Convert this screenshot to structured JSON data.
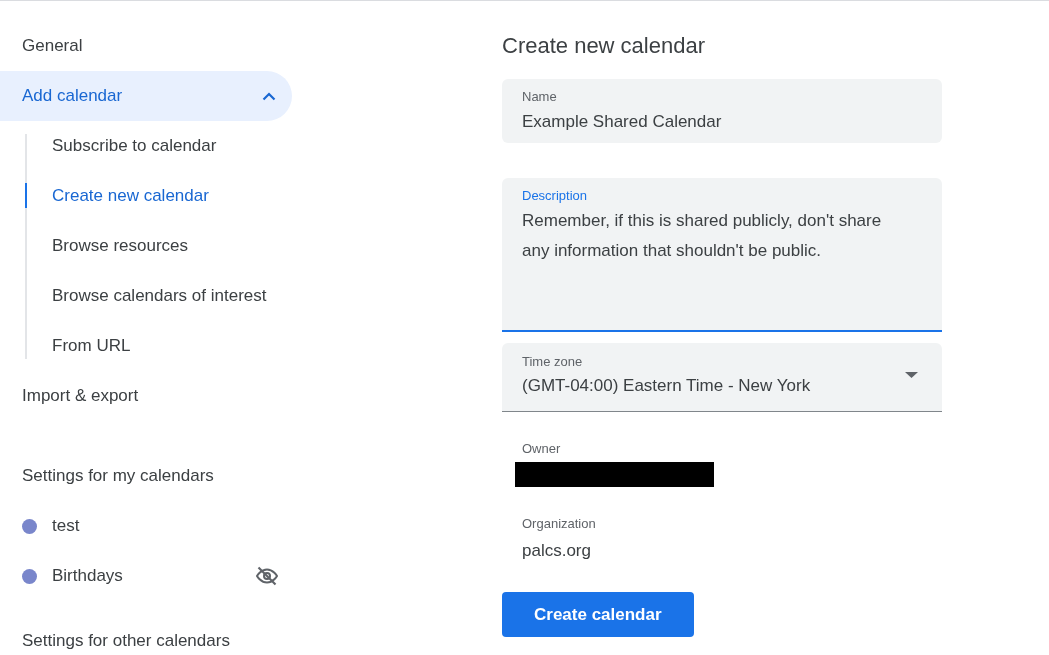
{
  "sidebar": {
    "items": [
      {
        "label": "General",
        "selected": false
      },
      {
        "label": "Add calendar",
        "selected": true,
        "expanded": true,
        "children": [
          {
            "label": "Subscribe to calendar",
            "selected": false
          },
          {
            "label": "Create new calendar",
            "selected": true
          },
          {
            "label": "Browse resources",
            "selected": false
          },
          {
            "label": "Browse calendars of interest",
            "selected": false
          },
          {
            "label": "From URL",
            "selected": false
          }
        ]
      },
      {
        "label": "Import & export",
        "selected": false
      }
    ],
    "sections": [
      {
        "title": "Settings for my calendars",
        "calendars": [
          {
            "name": "test",
            "color": "#7986cb",
            "hidden": false
          },
          {
            "name": "Birthdays",
            "color": "#7986cb",
            "hidden": true
          }
        ]
      },
      {
        "title": "Settings for other calendars"
      }
    ]
  },
  "form": {
    "title": "Create new calendar",
    "fields": [
      {
        "kind": "text",
        "label": "Name",
        "value": "Example Shared Calendar",
        "focused": false
      },
      {
        "kind": "textarea",
        "label": "Description",
        "value": "Remember, if this is shared publicly, don't share any information that shouldn't be public.",
        "focused": true
      },
      {
        "kind": "select",
        "label": "Time zone",
        "value": "(GMT-04:00) Eastern Time - New York",
        "focused": false
      }
    ],
    "details": [
      {
        "label": "Owner",
        "redacted": true
      },
      {
        "label": "Organization",
        "value": "palcs.org",
        "redacted": false
      }
    ],
    "button": "Create calendar"
  }
}
